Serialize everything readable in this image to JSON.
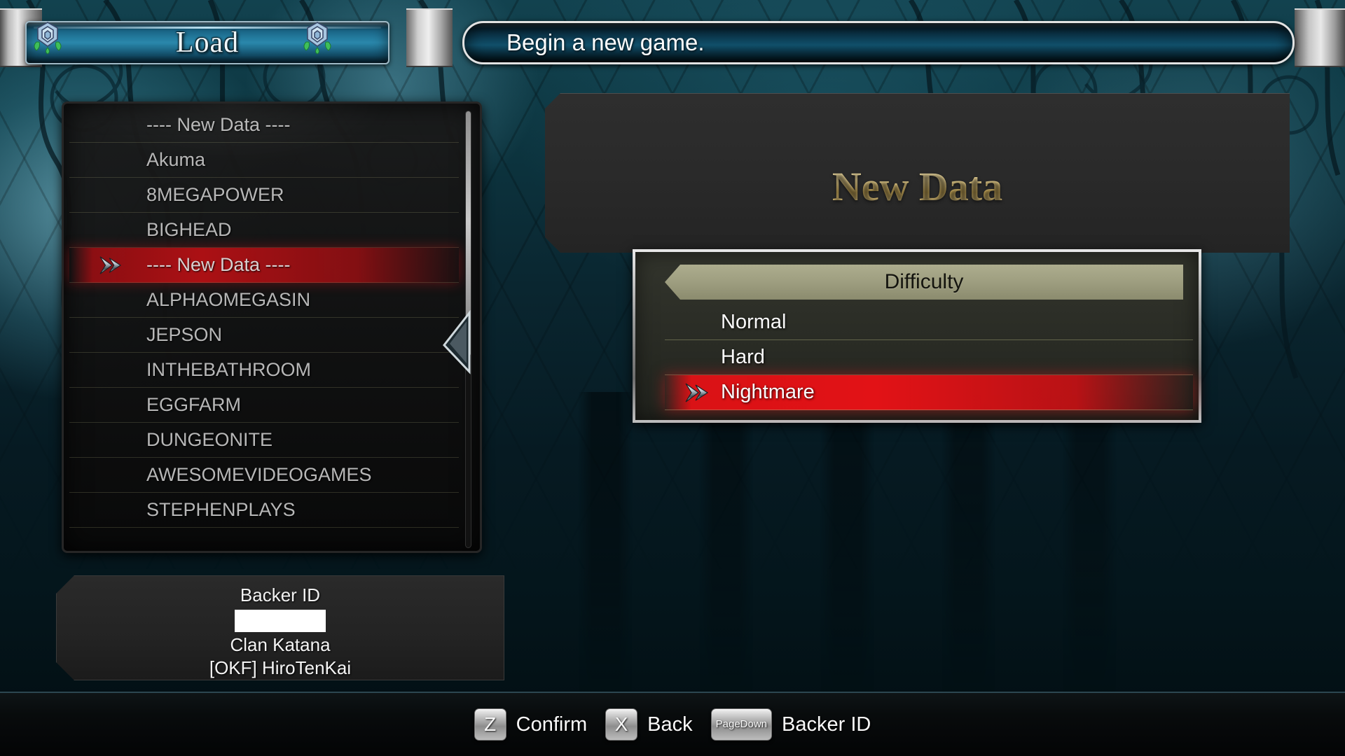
{
  "header": {
    "load_title": "Load",
    "message": "Begin a new game.",
    "rose_icon": "rose-emblem-icon"
  },
  "save_list": {
    "scroll_position": "top",
    "items": [
      {
        "label": "---- New Data ----",
        "selected": false
      },
      {
        "label": "Akuma",
        "selected": false
      },
      {
        "label": "8MEGAPOWER",
        "selected": false
      },
      {
        "label": "BIGHEAD",
        "selected": false
      },
      {
        "label": "---- New Data ----",
        "selected": true
      },
      {
        "label": "ALPHAOMEGASIN",
        "selected": false
      },
      {
        "label": "JEPSON",
        "selected": false
      },
      {
        "label": "INTHEBATHROOM",
        "selected": false
      },
      {
        "label": "EGGFARM",
        "selected": false
      },
      {
        "label": "DUNGEONITE",
        "selected": false
      },
      {
        "label": "AWESOMEVIDEOGAMES",
        "selected": false
      },
      {
        "label": "STEPHENPLAYS",
        "selected": false
      }
    ]
  },
  "nav": {
    "left_arrow_icon": "arrow-left-icon"
  },
  "backer": {
    "title": "Backer ID",
    "redacted_value": "",
    "clan": "Clan Katana",
    "username": "[OKF] HiroTenKai"
  },
  "detail": {
    "title": "New Data"
  },
  "difficulty": {
    "header": "Difficulty",
    "options": [
      {
        "label": "Normal",
        "selected": false
      },
      {
        "label": "Hard",
        "selected": false
      },
      {
        "label": "Nightmare",
        "selected": true
      }
    ],
    "cursor_icon": "double-chevron-cursor-icon"
  },
  "footer": {
    "hints": [
      {
        "key": "Z",
        "key_lines": [
          "Z"
        ],
        "label": "Confirm"
      },
      {
        "key": "X",
        "key_lines": [
          "X"
        ],
        "label": "Back"
      },
      {
        "key": "Page Down",
        "key_lines": [
          "Page",
          "Down"
        ],
        "label": "Backer ID"
      }
    ]
  },
  "colors": {
    "selection_red": "#dd1115",
    "gold_title": "#e6cf8e",
    "header_blue": "#2a87ab",
    "difficulty_banner": "#9c9c7e"
  }
}
